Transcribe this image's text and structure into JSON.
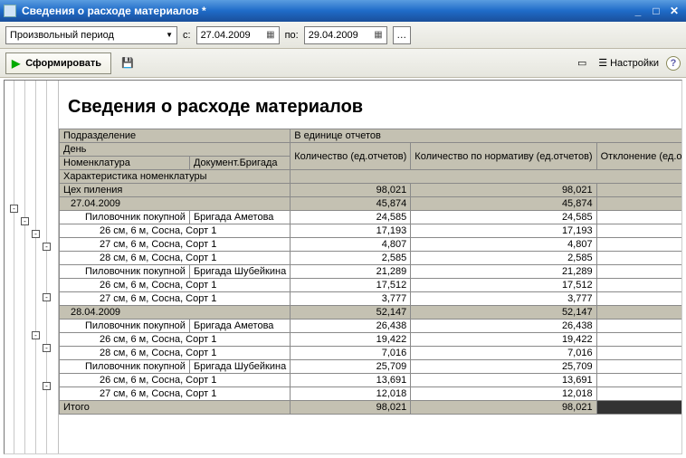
{
  "window": {
    "title": "Сведения о расходе материалов *"
  },
  "toolbar": {
    "period_select": "Произвольный период",
    "label_from": "с:",
    "date_from": "27.04.2009",
    "label_to": "по:",
    "date_to": "29.04.2009"
  },
  "actions": {
    "form_label": "Сформировать",
    "settings_label": "Настройки"
  },
  "report": {
    "title": "Сведения о расходе материалов",
    "headers": {
      "subdivision": "Подразделение",
      "units_group": "В единице отчетов",
      "day": "День",
      "nomenclature": "Номенклатура",
      "doc_brigade": "Документ.Бригада",
      "qty": "Количество (ед.отчетов)",
      "qty_norm": "Количество по нормативу (ед.отчетов)",
      "deviation": "Отклонение (ед.отчетов)"
    },
    "characteristic_label": "Характеристика номенклатуры",
    "rows": [
      {
        "level": 0,
        "summary": true,
        "label": "Цех пиления",
        "qty": "98,021",
        "norm": "98,021",
        "dev": ""
      },
      {
        "level": 1,
        "summary": true,
        "label": "27.04.2009",
        "qty": "45,874",
        "norm": "45,874",
        "dev": ""
      },
      {
        "level": 2,
        "label": "Пиловочник покупной",
        "col2": "Бригада Аметова",
        "qty": "24,585",
        "norm": "24,585",
        "dev": ""
      },
      {
        "level": 3,
        "label": "26 см, 6 м, Сосна, Сорт 1",
        "qty": "17,193",
        "norm": "17,193",
        "dev": ""
      },
      {
        "level": 3,
        "label": "27 см, 6 м, Сосна, Сорт 1",
        "qty": "4,807",
        "norm": "4,807",
        "dev": ""
      },
      {
        "level": 3,
        "label": "28 см, 6 м, Сосна, Сорт 1",
        "qty": "2,585",
        "norm": "2,585",
        "dev": ""
      },
      {
        "level": 2,
        "label": "Пиловочник покупной",
        "col2": "Бригада Шубейкина",
        "qty": "21,289",
        "norm": "21,289",
        "dev": ""
      },
      {
        "level": 3,
        "label": "26 см, 6 м, Сосна, Сорт 1",
        "qty": "17,512",
        "norm": "17,512",
        "dev": ""
      },
      {
        "level": 3,
        "label": "27 см, 6 м, Сосна, Сорт 1",
        "qty": "3,777",
        "norm": "3,777",
        "dev": ""
      },
      {
        "level": 1,
        "summary": true,
        "label": "28.04.2009",
        "qty": "52,147",
        "norm": "52,147",
        "dev": ""
      },
      {
        "level": 2,
        "label": "Пиловочник покупной",
        "col2": "Бригада Аметова",
        "qty": "26,438",
        "norm": "26,438",
        "dev": ""
      },
      {
        "level": 3,
        "label": "26 см, 6 м, Сосна, Сорт 1",
        "qty": "19,422",
        "norm": "19,422",
        "dev": ""
      },
      {
        "level": 3,
        "label": "28 см, 6 м, Сосна, Сорт 1",
        "qty": "7,016",
        "norm": "7,016",
        "dev": ""
      },
      {
        "level": 2,
        "label": "Пиловочник покупной",
        "col2": "Бригада Шубейкина",
        "qty": "25,709",
        "norm": "25,709",
        "dev": ""
      },
      {
        "level": 3,
        "label": "26 см, 6 м, Сосна, Сорт 1",
        "qty": "13,691",
        "norm": "13,691",
        "dev": ""
      },
      {
        "level": 3,
        "label": "27 см, 6 м, Сосна, Сорт 1",
        "qty": "12,018",
        "norm": "12,018",
        "dev": ""
      }
    ],
    "total_label": "Итого",
    "total_qty": "98,021",
    "total_norm": "98,021",
    "total_dev": ""
  }
}
